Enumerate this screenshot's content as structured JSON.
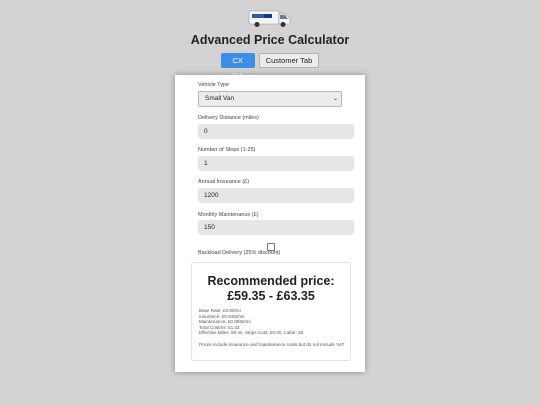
{
  "app": {
    "title": "Advanced Price Calculator"
  },
  "tabs": [
    {
      "label": "CX Tab",
      "active": true
    },
    {
      "label": "Customer Tab",
      "active": false
    }
  ],
  "form": {
    "vehicle_type": {
      "label": "Vehicle Type",
      "value": "Small Van"
    },
    "delivery_distance": {
      "label": "Delivery Distance (miles)",
      "value": "0"
    },
    "stops": {
      "label": "Number of Stops (1-25)",
      "value": "1"
    },
    "insurance": {
      "label": "Annual Insurance (£)",
      "value": "1200"
    },
    "maintenance": {
      "label": "Monthly Maintenance (£)",
      "value": "150"
    },
    "backload": {
      "label": "Backload Delivery (25% discount)",
      "checked": false
    }
  },
  "result": {
    "heading": "Recommended price:",
    "price_range": "£59.35 - £63.35",
    "details": [
      "Base Rate: £0.80/mi",
      "Insurance: £0.0462/mi",
      "Maintenance: £0.0692/mi",
      "Total Cost/mi: £1.03",
      "Effective Miles: 50 mi, Stops Cost: £0.00, Labor: £5"
    ],
    "note": "Prices include insurance and maintenance costs but do not include VAT"
  },
  "colors": {
    "accent": "#3e8ee6",
    "background": "#d3d3d3",
    "card": "#ffffff"
  }
}
